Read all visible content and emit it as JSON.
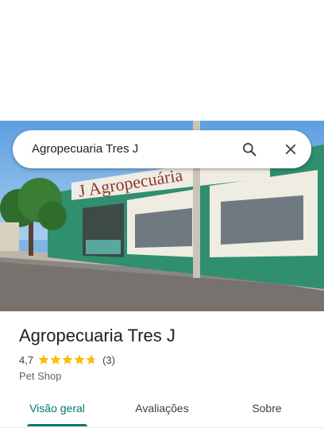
{
  "search": {
    "query": "Agropecuaria Tres J",
    "search_icon": "search-icon",
    "close_icon": "close-icon"
  },
  "photo": {
    "sign_text": "J Agropecuária"
  },
  "place": {
    "name": "Agropecuaria Tres J",
    "rating": "4,7",
    "rating_stars": 4.7,
    "review_count": "(3)",
    "category": "Pet Shop"
  },
  "tabs": [
    {
      "label": "Visão geral",
      "active": true
    },
    {
      "label": "Avaliações",
      "active": false
    },
    {
      "label": "Sobre",
      "active": false
    }
  ],
  "colors": {
    "accent": "#00796b",
    "star": "#fbbc04",
    "text_primary": "#202124",
    "text_secondary": "#5f6368"
  }
}
